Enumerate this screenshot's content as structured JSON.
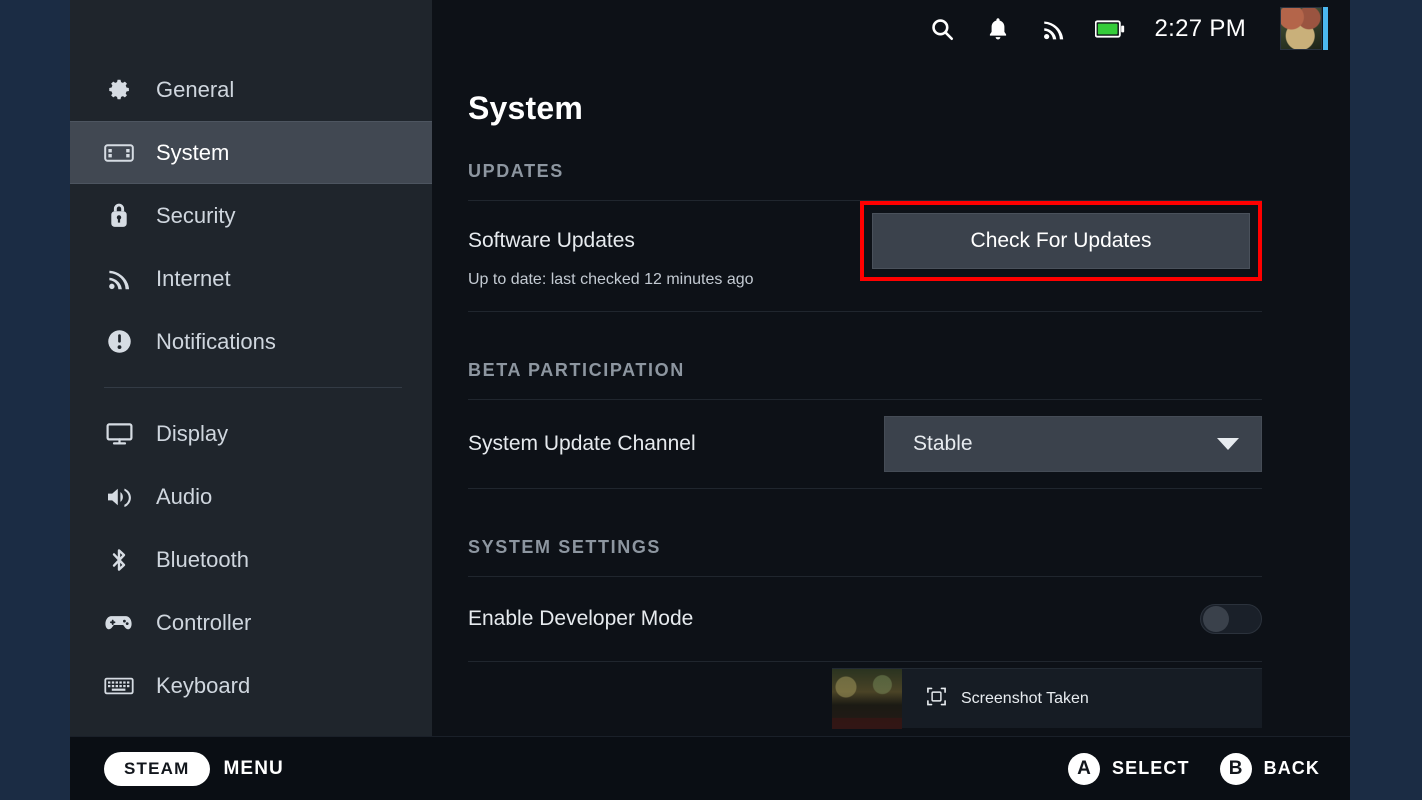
{
  "statusbar": {
    "icons": [
      "search-icon",
      "notifications-bell-icon",
      "wifi-icon",
      "battery-icon"
    ],
    "time": "2:27 PM",
    "battery_color": "#35cc3a",
    "avatar_status_color": "#4bb8f0"
  },
  "sidebar": {
    "items": [
      {
        "label": "General",
        "icon": "gear-icon",
        "selected": false
      },
      {
        "label": "System",
        "icon": "steamdeck-icon",
        "selected": true
      },
      {
        "label": "Security",
        "icon": "lock-icon",
        "selected": false
      },
      {
        "label": "Internet",
        "icon": "wifi-icon",
        "selected": false
      },
      {
        "label": "Notifications",
        "icon": "notification-icon",
        "selected": false
      },
      {
        "label": "Display",
        "icon": "monitor-icon",
        "selected": false
      },
      {
        "label": "Audio",
        "icon": "speaker-icon",
        "selected": false
      },
      {
        "label": "Bluetooth",
        "icon": "bluetooth-icon",
        "selected": false
      },
      {
        "label": "Controller",
        "icon": "gamepad-icon",
        "selected": false
      },
      {
        "label": "Keyboard",
        "icon": "keyboard-icon",
        "selected": false
      }
    ],
    "separator_after_index": 4
  },
  "main": {
    "title": "System",
    "sections": [
      {
        "label": "UPDATES",
        "row_label": "Software Updates",
        "button_label": "Check For Updates",
        "note": "Up to date: last checked 12 minutes ago",
        "highlight_color": "#ff0000"
      },
      {
        "label": "BETA PARTICIPATION",
        "row_label": "System Update Channel",
        "select_value": "Stable"
      },
      {
        "label": "SYSTEM SETTINGS",
        "row_label": "Enable Developer Mode",
        "toggle_on": false
      }
    ]
  },
  "toast": {
    "icon": "screenshot-icon",
    "text": "Screenshot Taken"
  },
  "footer": {
    "steam_label": "STEAM",
    "menu_label": "MENU",
    "hints": [
      {
        "key": "A",
        "label": "SELECT"
      },
      {
        "key": "B",
        "label": "BACK"
      }
    ]
  }
}
